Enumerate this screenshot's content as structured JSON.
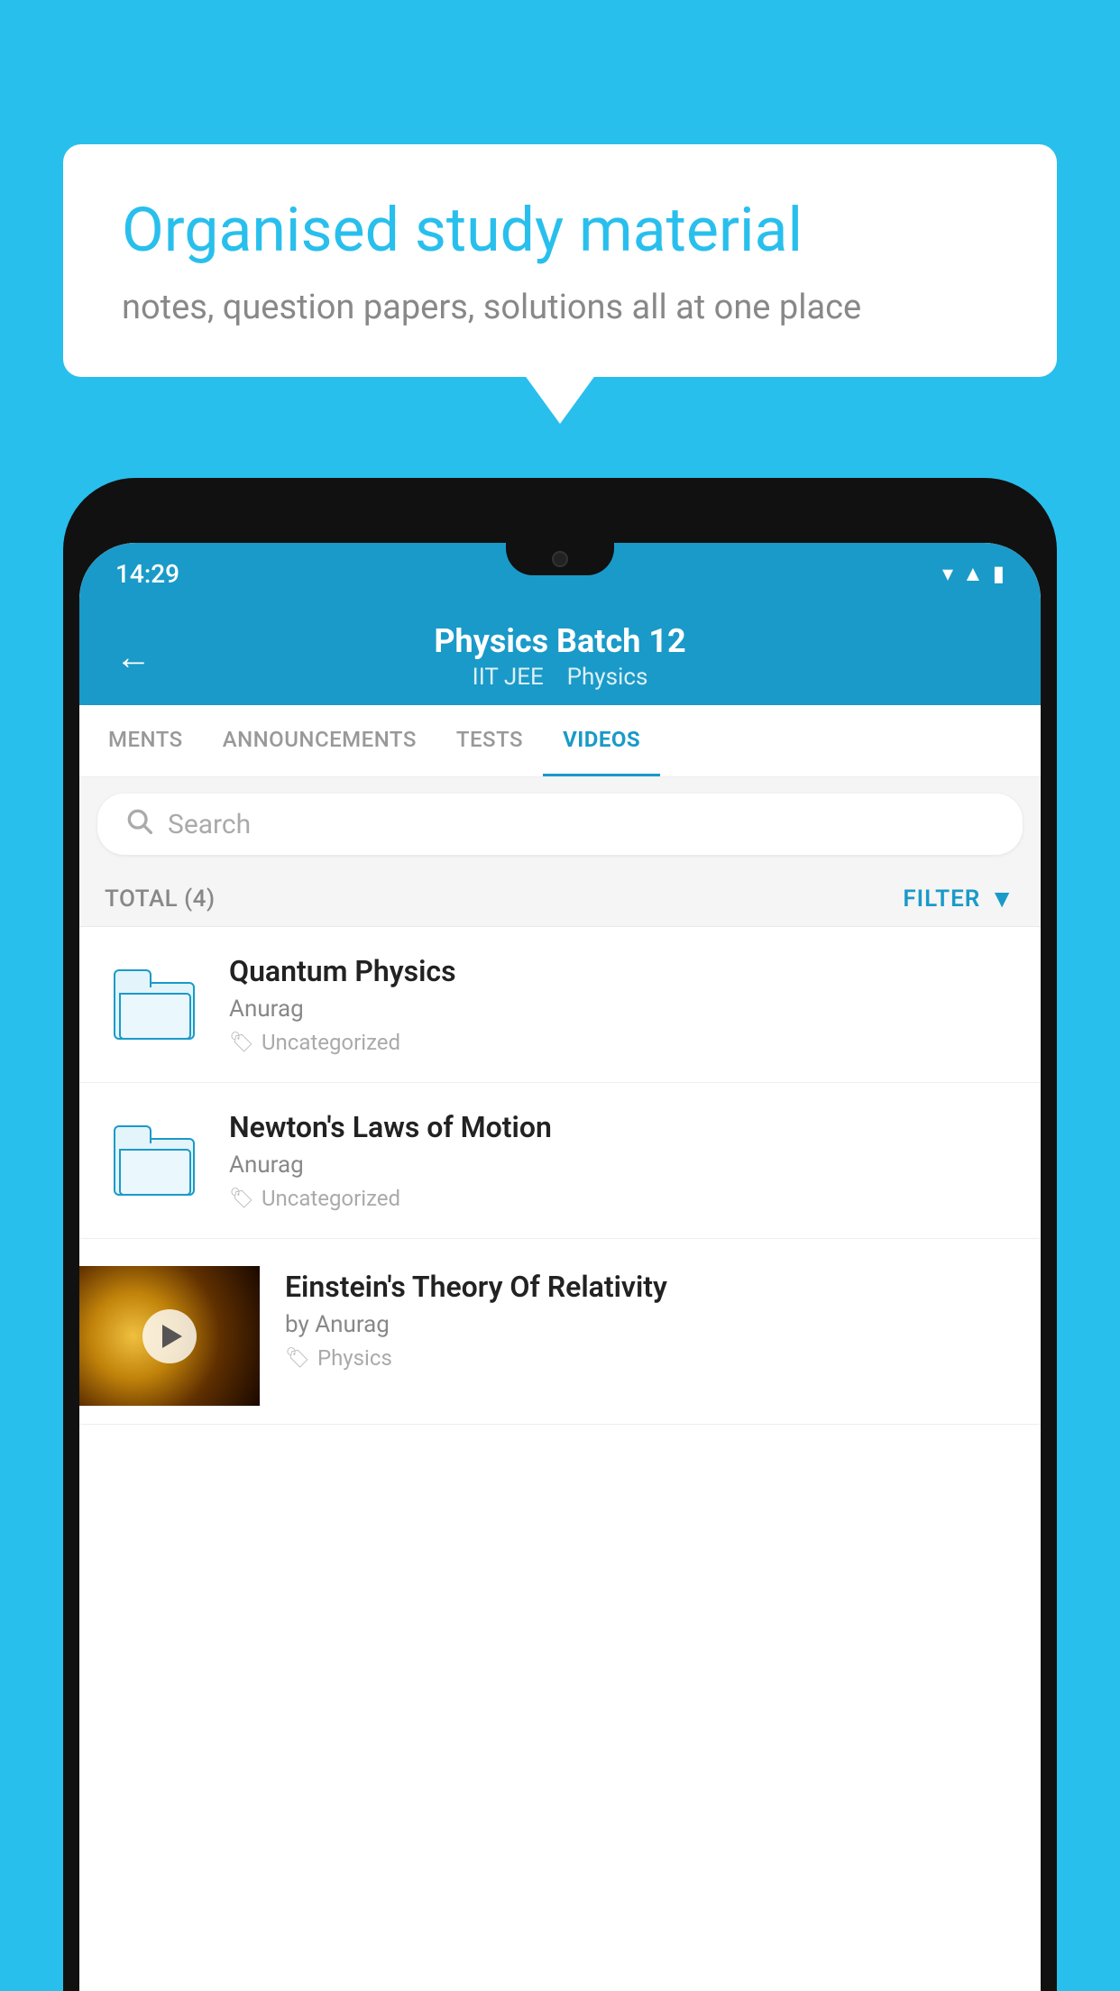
{
  "background_color": "#29BFED",
  "speech_bubble": {
    "title": "Organised study material",
    "subtitle": "notes, question papers, solutions all at one place"
  },
  "status_bar": {
    "time": "14:29",
    "wifi_icon": "▼",
    "signal_icon": "▲",
    "battery_icon": "▌"
  },
  "header": {
    "back_label": "←",
    "title": "Physics Batch 12",
    "tag1": "IIT JEE",
    "tag2": "Physics"
  },
  "tabs": [
    {
      "label": "MENTS",
      "active": false
    },
    {
      "label": "ANNOUNCEMENTS",
      "active": false
    },
    {
      "label": "TESTS",
      "active": false
    },
    {
      "label": "VIDEOS",
      "active": true
    }
  ],
  "search": {
    "placeholder": "Search"
  },
  "list_header": {
    "total_label": "TOTAL (4)",
    "filter_label": "FILTER"
  },
  "videos": [
    {
      "title": "Quantum Physics",
      "author": "Anurag",
      "tag": "Uncategorized",
      "has_thumbnail": false
    },
    {
      "title": "Newton's Laws of Motion",
      "author": "Anurag",
      "tag": "Uncategorized",
      "has_thumbnail": false
    },
    {
      "title": "Einstein's Theory Of Relativity",
      "author": "by Anurag",
      "tag": "Physics",
      "has_thumbnail": true
    }
  ]
}
